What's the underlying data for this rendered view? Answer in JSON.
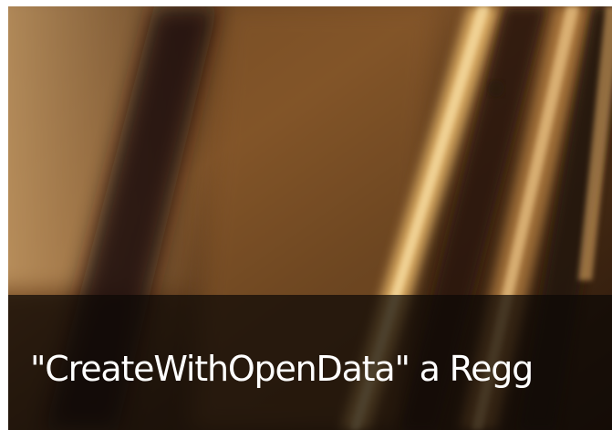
{
  "card": {
    "title": "\"CreateWithOpenData\" a Regg"
  },
  "colors": {
    "image_base": "#3a2413",
    "image_highlight": "#e8b86a",
    "caption_overlay": "#0c0805",
    "caption_text": "#ffffff"
  }
}
